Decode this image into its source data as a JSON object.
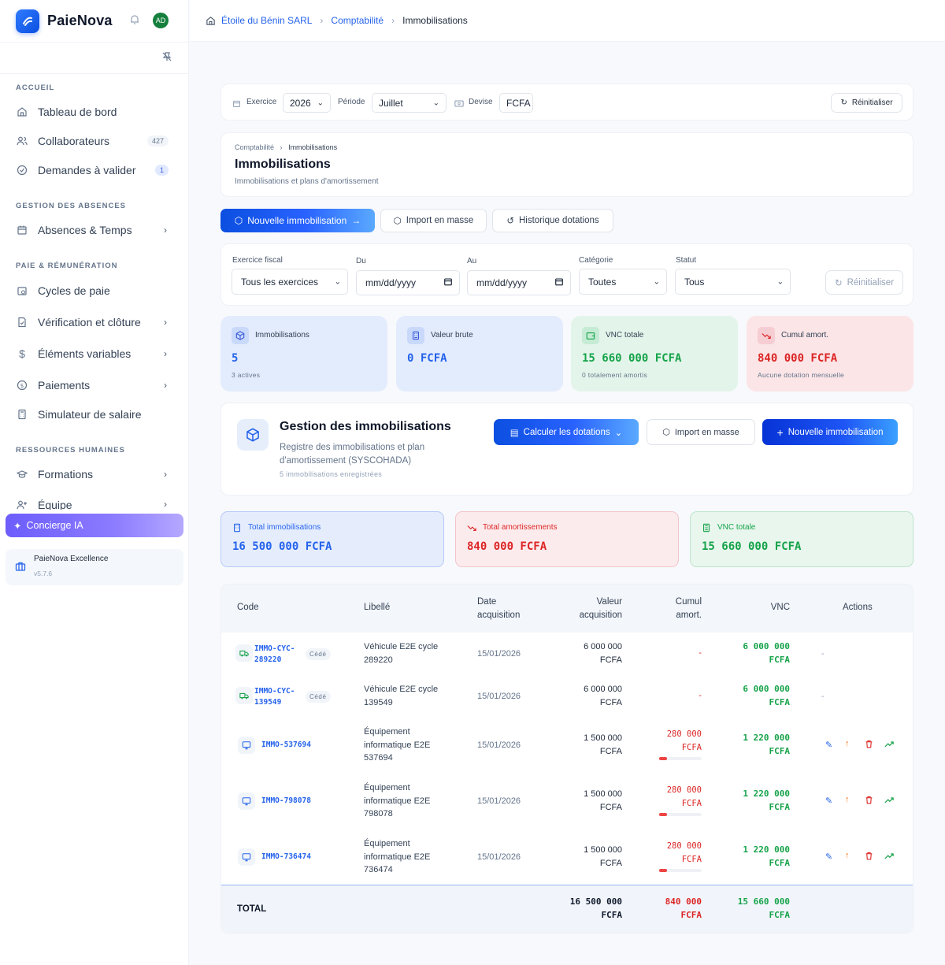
{
  "app": {
    "name": "PaieNova",
    "user_initials": "AD"
  },
  "breadcrumb": [
    "Étoile du Bénin SARL",
    "Comptabilité",
    "Immobilisations"
  ],
  "sidebar": {
    "sections": [
      {
        "title": "ACCUEIL"
      },
      {
        "title": "GESTION DES ABSENCES"
      },
      {
        "title": "PAIE & RÉMUNÉRATION"
      },
      {
        "title": "RESSOURCES HUMAINES"
      }
    ],
    "items": [
      {
        "label": "Tableau de bord",
        "icon": "home-icon"
      },
      {
        "label": "Collaborateurs",
        "icon": "users-icon",
        "badge": "427"
      },
      {
        "label": "Demandes à valider",
        "icon": "check-circle-icon",
        "badge": "1"
      },
      {
        "label": "Absences & Temps",
        "icon": "calendar-icon"
      },
      {
        "label": "Cycles de paie",
        "icon": "calendar-clock-icon"
      },
      {
        "label": "Vérification et clôture",
        "icon": "file-check-icon"
      },
      {
        "label": "Éléments variables",
        "icon": "dollar-icon"
      },
      {
        "label": "Paiements",
        "icon": "coin-icon"
      },
      {
        "label": "Simulateur de salaire",
        "icon": "calculator-icon"
      },
      {
        "label": "Formations",
        "icon": "graduation-cap-icon"
      },
      {
        "label": "Équipe",
        "icon": "user-plus-icon"
      }
    ],
    "concierge": "Concierge IA",
    "edition": "PaieNova Excellence",
    "version": "v5.7.6"
  },
  "topfilters": {
    "exercice_label": "Exercice",
    "exercice_value": "2026",
    "periode_label": "Période",
    "periode_value": "Juillet",
    "devise_label": "Devise",
    "devise_value": "FCFA",
    "reset": "Réinitialiser"
  },
  "header": {
    "crumb_parent": "Comptabilité",
    "crumb_current": "Immobilisations",
    "title": "Immobilisations",
    "subtitle": "Immobilisations et plans d'amortissement"
  },
  "actions": {
    "new": "Nouvelle immobilisation",
    "import": "Import en masse",
    "history": "Historique dotations"
  },
  "filters": {
    "fiscal_label": "Exercice fiscal",
    "fiscal_value": "Tous les exercices",
    "du_label": "Du",
    "du_value": "mm/dd/yyyy",
    "au_label": "Au",
    "au_value": "mm/dd/yyyy",
    "cat_label": "Catégorie",
    "cat_value": "Toutes",
    "statut_label": "Statut",
    "statut_value": "Tous",
    "reset": "Réinitialiser"
  },
  "stats": [
    {
      "label": "Immobilisations",
      "value": "5",
      "sub": "3 actives"
    },
    {
      "label": "Valeur brute",
      "value": "0 FCFA",
      "sub": ""
    },
    {
      "label": "VNC totale",
      "value": "15 660 000 FCFA",
      "sub": "0 totalement amortis"
    },
    {
      "label": "Cumul amort.",
      "value": "840 000 FCFA",
      "sub": "Aucune dotation mensuelle"
    }
  ],
  "gestion": {
    "title": "Gestion des immobilisations",
    "subtitle": "Registre des immobilisations et plan d'amortissement (SYSCOHADA)",
    "count": "5 immobilisations enregistrées",
    "calc": "Calculer les dotations",
    "import": "Import en masse",
    "new": "Nouvelle immobilisation"
  },
  "totals": [
    {
      "label": "Total immobilisations",
      "value": "16 500 000 FCFA"
    },
    {
      "label": "Total amortissements",
      "value": "840 000 FCFA"
    },
    {
      "label": "VNC totale",
      "value": "15 660 000 FCFA"
    }
  ],
  "table": {
    "headers": {
      "code": "Code",
      "libelle": "Libellé",
      "date1": "Date",
      "date2": "acquisition",
      "valeur1": "Valeur",
      "valeur2": "acquisition",
      "cumul1": "Cumul",
      "cumul2": "amort.",
      "vnc": "VNC",
      "actions": "Actions"
    },
    "rows": [
      {
        "code1": "IMMO-CYC-",
        "code2": "289220",
        "tag": "Cédé",
        "lib1": "Véhicule E2E cycle",
        "lib2": "289220",
        "lib3": "",
        "date": "15/01/2026",
        "val1": "6 000 000",
        "val2": "FCFA",
        "cum1": "-",
        "cum2": "",
        "vnc1": "6 000 000",
        "vnc2": "FCFA",
        "act": "-",
        "progress": 0
      },
      {
        "code1": "IMMO-CYC-",
        "code2": "139549",
        "tag": "Cédé",
        "lib1": "Véhicule E2E cycle",
        "lib2": "139549",
        "lib3": "",
        "date": "15/01/2026",
        "val1": "6 000 000",
        "val2": "FCFA",
        "cum1": "-",
        "cum2": "",
        "vnc1": "6 000 000",
        "vnc2": "FCFA",
        "act": "-",
        "progress": 0
      },
      {
        "code1": "IMMO-537694",
        "code2": "",
        "tag": "",
        "lib1": "Équipement",
        "lib2": "informatique E2E",
        "lib3": "537694",
        "date": "15/01/2026",
        "val1": "1 500 000",
        "val2": "FCFA",
        "cum1": "280 000",
        "cum2": "FCFA",
        "vnc1": "1 220 000",
        "vnc2": "FCFA",
        "act": "",
        "progress": 0.187
      },
      {
        "code1": "IMMO-798078",
        "code2": "",
        "tag": "",
        "lib1": "Équipement",
        "lib2": "informatique E2E",
        "lib3": "798078",
        "date": "15/01/2026",
        "val1": "1 500 000",
        "val2": "FCFA",
        "cum1": "280 000",
        "cum2": "FCFA",
        "vnc1": "1 220 000",
        "vnc2": "FCFA",
        "act": "",
        "progress": 0.187
      },
      {
        "code1": "IMMO-736474",
        "code2": "",
        "tag": "",
        "lib1": "Équipement",
        "lib2": "informatique E2E",
        "lib3": "736474",
        "date": "15/01/2026",
        "val1": "1 500 000",
        "val2": "FCFA",
        "cum1": "280 000",
        "cum2": "FCFA",
        "vnc1": "1 220 000",
        "vnc2": "FCFA",
        "act": "",
        "progress": 0.187
      }
    ],
    "total": {
      "label": "TOTAL",
      "val1": "16 500 000",
      "val2": "FCFA",
      "cum1": "840 000",
      "cum2": "FCFA",
      "vnc1": "15 660 000",
      "vnc2": "FCFA"
    }
  },
  "colors": {
    "primary": "#2563eb",
    "green": "#16a34a",
    "red": "#dc2626"
  }
}
